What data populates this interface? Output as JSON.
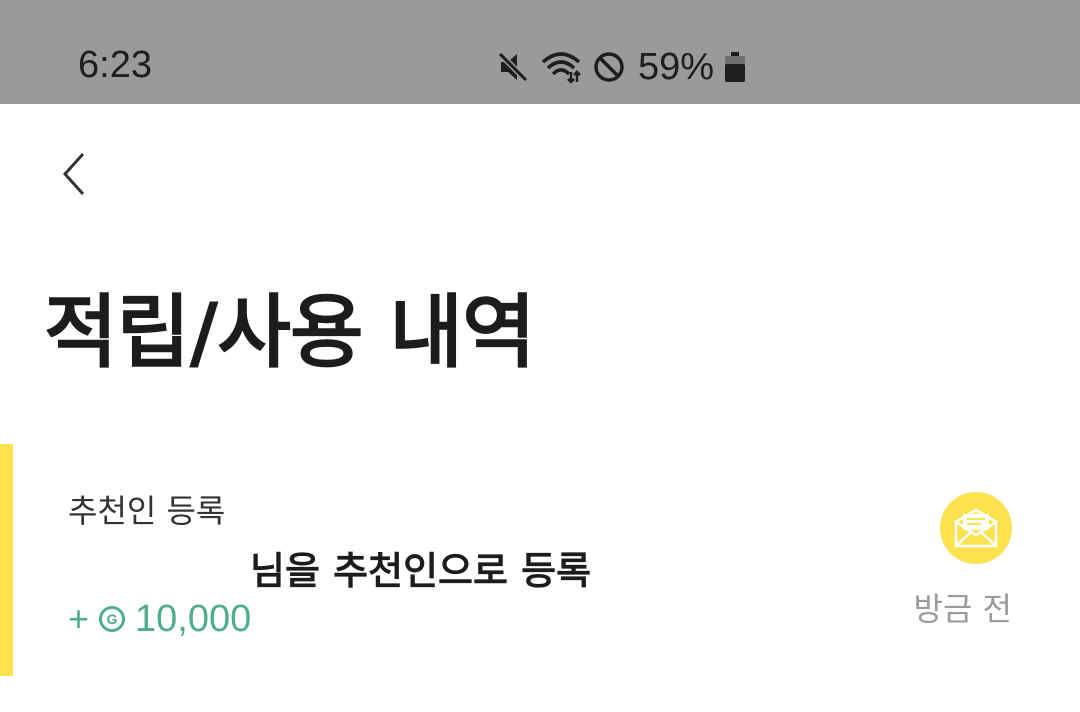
{
  "status_bar": {
    "time": "6:23",
    "battery": "59%",
    "icons": [
      "mute-icon",
      "wifi-icon",
      "do-not-disturb-icon",
      "battery-icon"
    ]
  },
  "header": {
    "back_icon": "chevron-left-icon",
    "title": "적립/사용 내역"
  },
  "history": [
    {
      "category": "추천인 등록",
      "description": "님을 추천인으로 등록",
      "amount_sign": "+",
      "coin_icon": "coin-icon",
      "coin_symbol": "G",
      "amount": "10,000",
      "time": "방금 전",
      "icon": "envelope-icon"
    }
  ],
  "colors": {
    "status_bar_bg": "#9a9a9a",
    "accent_yellow": "#fde24f",
    "amount_green": "#4fae8a",
    "muted_gray": "#9b9b9b"
  }
}
